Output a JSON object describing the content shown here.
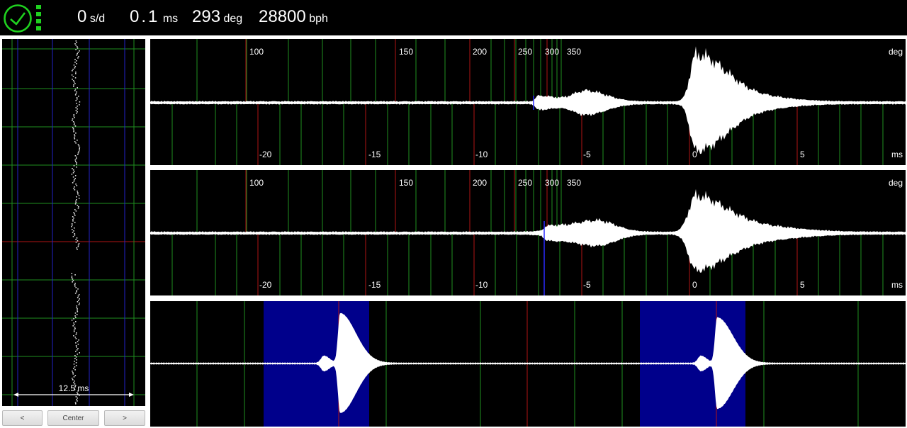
{
  "header": {
    "rate_value": "0",
    "rate_unit": "s/d",
    "beat_error_value": "0.1",
    "beat_error_unit": "ms",
    "amplitude_value": "293",
    "amplitude_unit": "deg",
    "bph_value": "28800",
    "bph_unit": "bph"
  },
  "timegrapher": {
    "span_label": "12.5 ms"
  },
  "waveform_top": {
    "deg_ticks": [
      "100",
      "150",
      "200",
      "250",
      "300",
      "350"
    ],
    "deg_unit": "deg",
    "ms_ticks": [
      "-20",
      "-15",
      "-10",
      "-5",
      "0",
      "5"
    ],
    "ms_unit": "ms"
  },
  "waveform_mid": {
    "deg_ticks": [
      "100",
      "150",
      "200",
      "250",
      "300",
      "350"
    ],
    "deg_unit": "deg",
    "ms_ticks": [
      "-20",
      "-15",
      "-10",
      "-5",
      "0",
      "5"
    ],
    "ms_unit": "ms"
  },
  "buttons": {
    "prev": "<",
    "center": "Center",
    "next": ">"
  },
  "colors": {
    "background": "#000000",
    "accent_green": "#1fd11f",
    "grid_green": "#1f8f1f",
    "grid_red": "#b01515",
    "grid_blue": "#2222c8",
    "highlight_blue": "#00008b",
    "signal": "#ffffff"
  },
  "icons": [
    "clock-icon",
    "status-dots-icon"
  ]
}
